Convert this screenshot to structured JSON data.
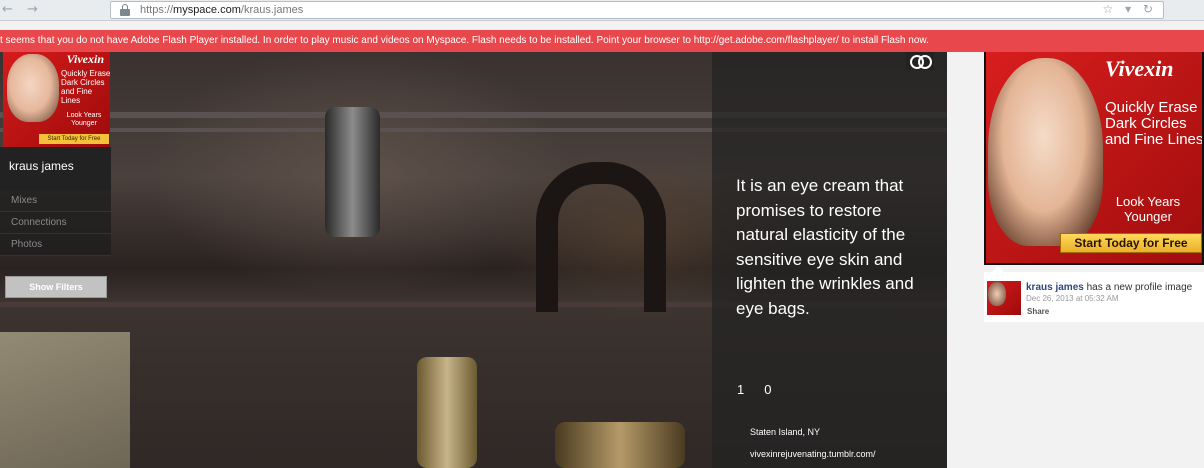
{
  "browser": {
    "back_icon": "←",
    "forward_icon": "→",
    "url_scheme": "https://",
    "url_domain": "myspace.com",
    "url_path": "/kraus.james",
    "right_icons": "☆ ▾ ↻"
  },
  "flash_warning": "t seems that you do not have Adobe Flash Player installed. In order to play music and videos on Myspace. Flash needs to be installed. Point your browser to http://get.adobe.com/flashplayer/ to install Flash now.",
  "profile": {
    "name": "kraus james",
    "nav": [
      "Mixes",
      "Connections",
      "Photos"
    ],
    "show_filters": "Show Filters",
    "ad": {
      "brand": "Vivexin",
      "headline": "Quickly Erase Dark Circles and Fine Lines",
      "sub": "Look Years Younger",
      "cta": "Start Today for Free"
    }
  },
  "post": {
    "quote": "It is an eye cream that promises to restore natural elasticity of the sensitive eye skin and lighten the wrinkles and eye bags.",
    "likes": "1",
    "comments": "0",
    "location": "Staten Island, NY",
    "link": "vivexinrejuvenating.tumblr.com/"
  },
  "right_ad": {
    "brand": "Vivexin",
    "headline": "Quickly Erase Dark Circles and Fine Lines",
    "sub": "Look Years Younger",
    "cta": "Start Today for Free"
  },
  "activity": {
    "who": "kraus james",
    "action": " has a new profile image",
    "date": "Dec 26, 2013 at 05:32 AM",
    "share": "Share"
  },
  "colors": {
    "flash_bar": "#e8484c",
    "ad_red": "#d51b1b",
    "ad_button": "#f3c23a"
  }
}
